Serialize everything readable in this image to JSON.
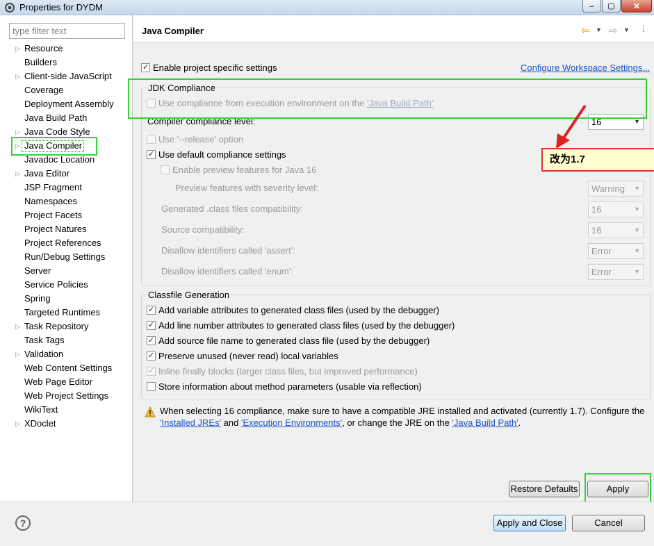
{
  "window": {
    "title": "Properties for DYDM",
    "minimize_glyph": "–",
    "maximize_glyph": "▢",
    "close_glyph": "✕"
  },
  "filter": {
    "placeholder": "type filter text"
  },
  "tree": {
    "items": [
      {
        "label": "Resource",
        "expandable": true
      },
      {
        "label": "Builders",
        "expandable": false
      },
      {
        "label": "Client-side JavaScript",
        "expandable": true
      },
      {
        "label": "Coverage",
        "expandable": false
      },
      {
        "label": "Deployment Assembly",
        "expandable": false
      },
      {
        "label": "Java Build Path",
        "expandable": false
      },
      {
        "label": "Java Code Style",
        "expandable": true
      },
      {
        "label": "Java Compiler",
        "expandable": true,
        "selected": true
      },
      {
        "label": "Javadoc Location",
        "expandable": false
      },
      {
        "label": "Java Editor",
        "expandable": true
      },
      {
        "label": "JSP Fragment",
        "expandable": false
      },
      {
        "label": "Namespaces",
        "expandable": false
      },
      {
        "label": "Project Facets",
        "expandable": false
      },
      {
        "label": "Project Natures",
        "expandable": false
      },
      {
        "label": "Project References",
        "expandable": false
      },
      {
        "label": "Run/Debug Settings",
        "expandable": false
      },
      {
        "label": "Server",
        "expandable": false
      },
      {
        "label": "Service Policies",
        "expandable": false
      },
      {
        "label": "Spring",
        "expandable": false
      },
      {
        "label": "Targeted Runtimes",
        "expandable": false
      },
      {
        "label": "Task Repository",
        "expandable": true
      },
      {
        "label": "Task Tags",
        "expandable": false
      },
      {
        "label": "Validation",
        "expandable": true
      },
      {
        "label": "Web Content Settings",
        "expandable": false
      },
      {
        "label": "Web Page Editor",
        "expandable": false
      },
      {
        "label": "Web Project Settings",
        "expandable": false
      },
      {
        "label": "WikiText",
        "expandable": false
      },
      {
        "label": "XDoclet",
        "expandable": true
      }
    ]
  },
  "page": {
    "title": "Java Compiler",
    "enable_project_specific": "Enable project specific settings",
    "configure_workspace": "Configure Workspace Settings...",
    "jdk": {
      "group_title": "JDK Compliance",
      "use_exec_env_prefix": "Use compliance from execution environment on the ",
      "use_exec_env_link": "'Java Build Path'",
      "compliance_level_label": "Compiler compliance level:",
      "compliance_level_value": "16",
      "release_option": "Use '--release' option",
      "use_default": "Use default compliance settings",
      "enable_preview": "Enable preview features for Java 16",
      "preview_severity_label": "Preview features with severity level:",
      "preview_severity_value": "Warning",
      "generated_compat_label": "Generated .class files compatibility:",
      "generated_compat_value": "16",
      "source_compat_label": "Source compatibility:",
      "source_compat_value": "16",
      "assert_label": "Disallow identifiers called 'assert':",
      "assert_value": "Error",
      "enum_label": "Disallow identifiers called 'enum':",
      "enum_value": "Error"
    },
    "classfile": {
      "group_title": "Classfile Generation",
      "opt1": "Add variable attributes to generated class files (used by the debugger)",
      "opt2": "Add line number attributes to generated class files (used by the debugger)",
      "opt3": "Add source file name to generated class file (used by the debugger)",
      "opt4": "Preserve unused (never read) local variables",
      "opt5": "Inline finally blocks (larger class files, but improved performance)",
      "opt6": "Store information about method parameters (usable via reflection)"
    },
    "warning": {
      "text1": "When selecting 16 compliance, make sure to have a compatible JRE installed and activated (currently 1.7). Configure the",
      "link1": "'Installed JREs'",
      "and": " and ",
      "link2": "'Execution Environments'",
      "text2": ", or change the JRE on the ",
      "link3": "'Java Build Path'",
      "text3": "."
    },
    "restore_defaults": "Restore Defaults",
    "apply": "Apply"
  },
  "annotation": {
    "callout_text": "改为1.7",
    "color": "#dd2222",
    "highlight_color": "#35d035"
  },
  "footer": {
    "help_glyph": "?",
    "apply_and_close": "Apply and Close",
    "cancel": "Cancel"
  },
  "colors": {
    "link": "#1a55c8",
    "title_bar": "#c6d8ec",
    "panel_bg": "#f0f0f0"
  }
}
